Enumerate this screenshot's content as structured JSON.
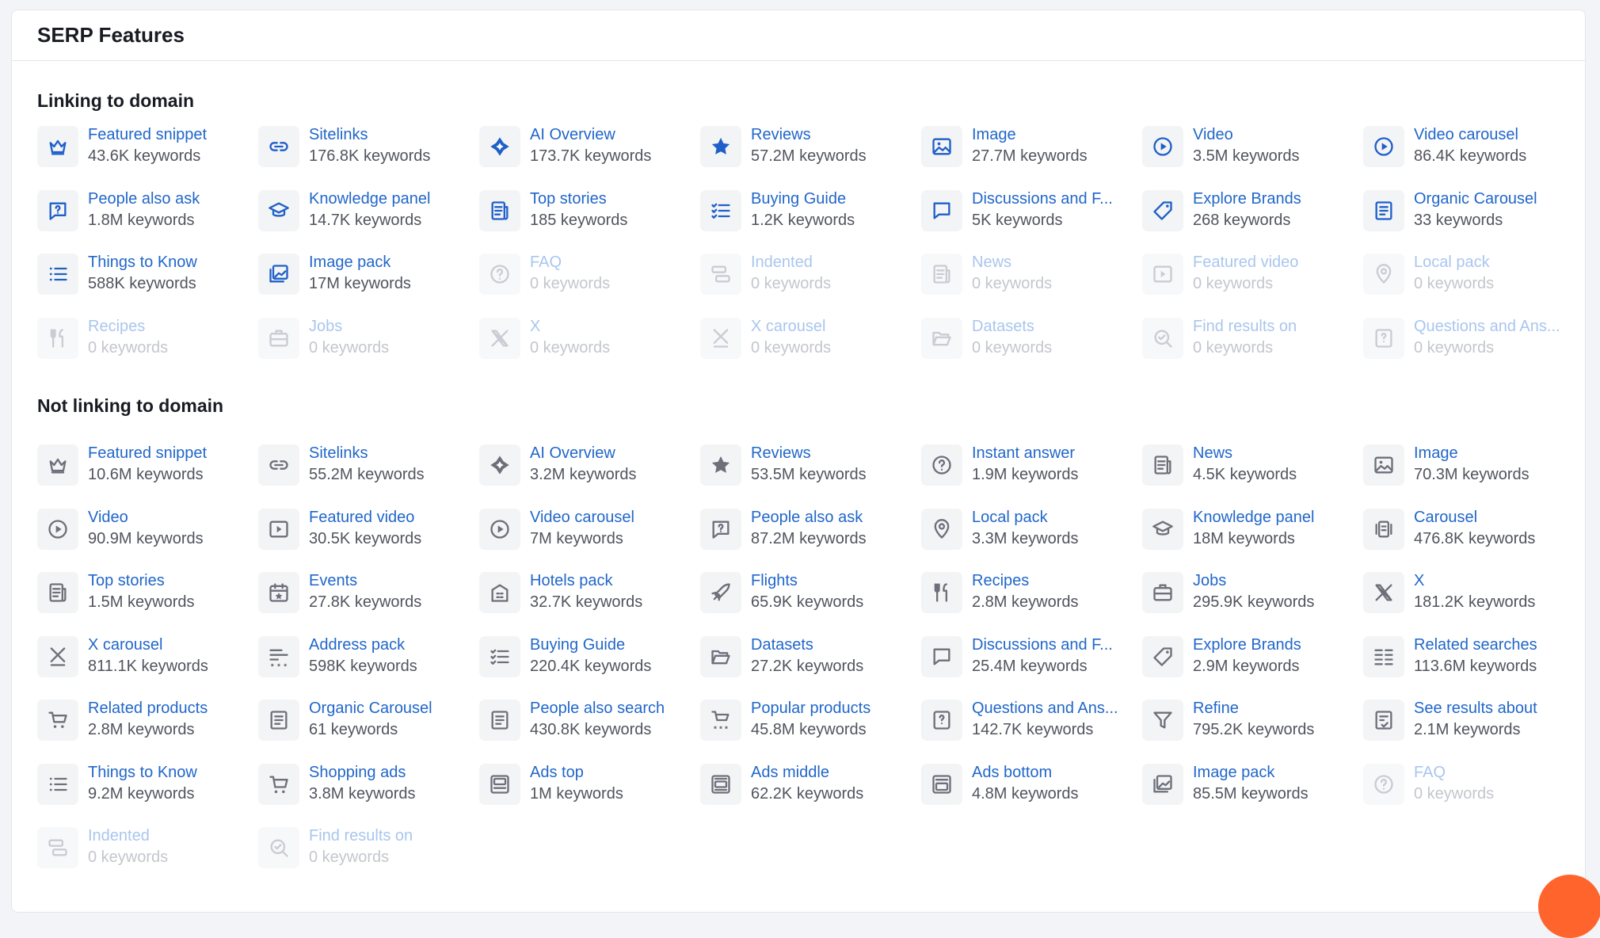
{
  "page_title": "SERP Features",
  "sections": [
    {
      "id": "linking",
      "title": "Linking to domain",
      "items": [
        {
          "label": "Featured snippet",
          "count": "43.6K keywords",
          "icon": "crown-icon",
          "state": "active"
        },
        {
          "label": "Sitelinks",
          "count": "176.8K keywords",
          "icon": "link-icon",
          "state": "active"
        },
        {
          "label": "AI Overview",
          "count": "173.7K keywords",
          "icon": "ai-diamond-icon",
          "state": "active"
        },
        {
          "label": "Reviews",
          "count": "57.2M keywords",
          "icon": "star-icon",
          "state": "active"
        },
        {
          "label": "Image",
          "count": "27.7M keywords",
          "icon": "image-icon",
          "state": "active"
        },
        {
          "label": "Video",
          "count": "3.5M keywords",
          "icon": "play-circle-icon",
          "state": "active"
        },
        {
          "label": "Video carousel",
          "count": "86.4K keywords",
          "icon": "play-circle-icon",
          "state": "active"
        },
        {
          "label": "People also ask",
          "count": "1.8M keywords",
          "icon": "question-square-icon",
          "state": "active"
        },
        {
          "label": "Knowledge panel",
          "count": "14.7K keywords",
          "icon": "graduation-cap-icon",
          "state": "active"
        },
        {
          "label": "Top stories",
          "count": "185 keywords",
          "icon": "news-icon",
          "state": "active"
        },
        {
          "label": "Buying Guide",
          "count": "1.2K keywords",
          "icon": "checklist-icon",
          "state": "active"
        },
        {
          "label": "Discussions and F...",
          "count": "5K keywords",
          "icon": "chat-bubble-icon",
          "state": "active"
        },
        {
          "label": "Explore Brands",
          "count": "268 keywords",
          "icon": "tag-icon",
          "state": "active"
        },
        {
          "label": "Organic Carousel",
          "count": "33 keywords",
          "icon": "document-icon",
          "state": "active"
        },
        {
          "label": "Things to Know",
          "count": "588K keywords",
          "icon": "list-icon",
          "state": "active"
        },
        {
          "label": "Image pack",
          "count": "17M keywords",
          "icon": "image-stack-icon",
          "state": "active"
        },
        {
          "label": "FAQ",
          "count": "0 keywords",
          "icon": "question-circle-icon",
          "state": "disabled"
        },
        {
          "label": "Indented",
          "count": "0 keywords",
          "icon": "indent-icon",
          "state": "disabled"
        },
        {
          "label": "News",
          "count": "0 keywords",
          "icon": "news-icon",
          "state": "disabled"
        },
        {
          "label": "Featured video",
          "count": "0 keywords",
          "icon": "play-square-icon",
          "state": "disabled"
        },
        {
          "label": "Local pack",
          "count": "0 keywords",
          "icon": "map-pin-icon",
          "state": "disabled"
        },
        {
          "label": "Recipes",
          "count": "0 keywords",
          "icon": "fork-knife-icon",
          "state": "disabled"
        },
        {
          "label": "Jobs",
          "count": "0 keywords",
          "icon": "briefcase-icon",
          "state": "disabled"
        },
        {
          "label": "X",
          "count": "0 keywords",
          "icon": "x-logo-icon",
          "state": "disabled"
        },
        {
          "label": "X carousel",
          "count": "0 keywords",
          "icon": "x-carousel-icon",
          "state": "disabled"
        },
        {
          "label": "Datasets",
          "count": "0 keywords",
          "icon": "folder-open-icon",
          "state": "disabled"
        },
        {
          "label": "Find results on",
          "count": "0 keywords",
          "icon": "search-check-icon",
          "state": "disabled"
        },
        {
          "label": "Questions and Ans...",
          "count": "0 keywords",
          "icon": "question-doc-icon",
          "state": "disabled"
        }
      ]
    },
    {
      "id": "notlinking",
      "title": "Not linking to domain",
      "items": [
        {
          "label": "Featured snippet",
          "count": "10.6M keywords",
          "icon": "crown-icon",
          "state": "neutral"
        },
        {
          "label": "Sitelinks",
          "count": "55.2M keywords",
          "icon": "link-icon",
          "state": "neutral"
        },
        {
          "label": "AI Overview",
          "count": "3.2M keywords",
          "icon": "ai-diamond-icon",
          "state": "neutral"
        },
        {
          "label": "Reviews",
          "count": "53.5M keywords",
          "icon": "star-icon",
          "state": "neutral"
        },
        {
          "label": "Instant answer",
          "count": "1.9M keywords",
          "icon": "question-circle-icon",
          "state": "neutral"
        },
        {
          "label": "News",
          "count": "4.5K keywords",
          "icon": "news-icon",
          "state": "neutral"
        },
        {
          "label": "Image",
          "count": "70.3M keywords",
          "icon": "image-icon",
          "state": "neutral"
        },
        {
          "label": "Video",
          "count": "90.9M keywords",
          "icon": "play-circle-icon",
          "state": "neutral"
        },
        {
          "label": "Featured video",
          "count": "30.5K keywords",
          "icon": "play-square-icon",
          "state": "neutral"
        },
        {
          "label": "Video carousel",
          "count": "7M keywords",
          "icon": "play-circle-icon",
          "state": "neutral"
        },
        {
          "label": "People also ask",
          "count": "87.2M keywords",
          "icon": "question-square-icon",
          "state": "neutral"
        },
        {
          "label": "Local pack",
          "count": "3.3M keywords",
          "icon": "map-pin-icon",
          "state": "neutral"
        },
        {
          "label": "Knowledge panel",
          "count": "18M keywords",
          "icon": "graduation-cap-icon",
          "state": "neutral"
        },
        {
          "label": "Carousel",
          "count": "476.8K keywords",
          "icon": "carousel-icon",
          "state": "neutral"
        },
        {
          "label": "Top stories",
          "count": "1.5M keywords",
          "icon": "news-icon",
          "state": "neutral"
        },
        {
          "label": "Events",
          "count": "27.8K keywords",
          "icon": "calendar-star-icon",
          "state": "neutral"
        },
        {
          "label": "Hotels pack",
          "count": "32.7K keywords",
          "icon": "hotel-icon",
          "state": "neutral"
        },
        {
          "label": "Flights",
          "count": "65.9K keywords",
          "icon": "plane-icon",
          "state": "neutral"
        },
        {
          "label": "Recipes",
          "count": "2.8M keywords",
          "icon": "fork-knife-icon",
          "state": "neutral"
        },
        {
          "label": "Jobs",
          "count": "295.9K keywords",
          "icon": "briefcase-icon",
          "state": "neutral"
        },
        {
          "label": "X",
          "count": "181.2K keywords",
          "icon": "x-logo-icon",
          "state": "neutral"
        },
        {
          "label": "X carousel",
          "count": "811.1K keywords",
          "icon": "x-carousel-icon",
          "state": "neutral"
        },
        {
          "label": "Address pack",
          "count": "598K keywords",
          "icon": "address-icon",
          "state": "neutral"
        },
        {
          "label": "Buying Guide",
          "count": "220.4K keywords",
          "icon": "checklist-icon",
          "state": "neutral"
        },
        {
          "label": "Datasets",
          "count": "27.2K keywords",
          "icon": "folder-open-icon",
          "state": "neutral"
        },
        {
          "label": "Discussions and F...",
          "count": "25.4M keywords",
          "icon": "chat-bubble-icon",
          "state": "neutral"
        },
        {
          "label": "Explore Brands",
          "count": "2.9M keywords",
          "icon": "tag-icon",
          "state": "neutral"
        },
        {
          "label": "Related searches",
          "count": "113.6M keywords",
          "icon": "two-column-list-icon",
          "state": "neutral"
        },
        {
          "label": "Related products",
          "count": "2.8M keywords",
          "icon": "cart-list-icon",
          "state": "neutral"
        },
        {
          "label": "Organic Carousel",
          "count": "61 keywords",
          "icon": "document-icon",
          "state": "neutral"
        },
        {
          "label": "People also search",
          "count": "430.8K keywords",
          "icon": "document-icon",
          "state": "neutral"
        },
        {
          "label": "Popular products",
          "count": "45.8M keywords",
          "icon": "cart-stars-icon",
          "state": "neutral"
        },
        {
          "label": "Questions and Ans...",
          "count": "142.7K keywords",
          "icon": "question-doc-icon",
          "state": "neutral"
        },
        {
          "label": "Refine",
          "count": "795.2K keywords",
          "icon": "filter-icon",
          "state": "neutral"
        },
        {
          "label": "See results about",
          "count": "2.1M keywords",
          "icon": "doc-check-icon",
          "state": "neutral"
        },
        {
          "label": "Things to Know",
          "count": "9.2M keywords",
          "icon": "list-icon",
          "state": "neutral"
        },
        {
          "label": "Shopping ads",
          "count": "3.8M keywords",
          "icon": "cart-icon",
          "state": "neutral"
        },
        {
          "label": "Ads top",
          "count": "1M keywords",
          "icon": "ad-top-icon",
          "state": "neutral"
        },
        {
          "label": "Ads middle",
          "count": "62.2K keywords",
          "icon": "ad-middle-icon",
          "state": "neutral"
        },
        {
          "label": "Ads bottom",
          "count": "4.8M keywords",
          "icon": "ad-bottom-icon",
          "state": "neutral"
        },
        {
          "label": "Image pack",
          "count": "85.5M keywords",
          "icon": "image-stack-icon",
          "state": "neutral"
        },
        {
          "label": "FAQ",
          "count": "0 keywords",
          "icon": "question-circle-icon",
          "state": "disabled"
        },
        {
          "label": "Indented",
          "count": "0 keywords",
          "icon": "indent-icon",
          "state": "disabled"
        },
        {
          "label": "Find results on",
          "count": "0 keywords",
          "icon": "search-check-icon",
          "state": "disabled"
        }
      ]
    }
  ],
  "colors": {
    "accent": "#2167c9",
    "icon_active": "#1f5fc9",
    "icon_neutral": "#6c707a",
    "disabled_label": "#a9c6ee",
    "fab": "#ff642d"
  }
}
